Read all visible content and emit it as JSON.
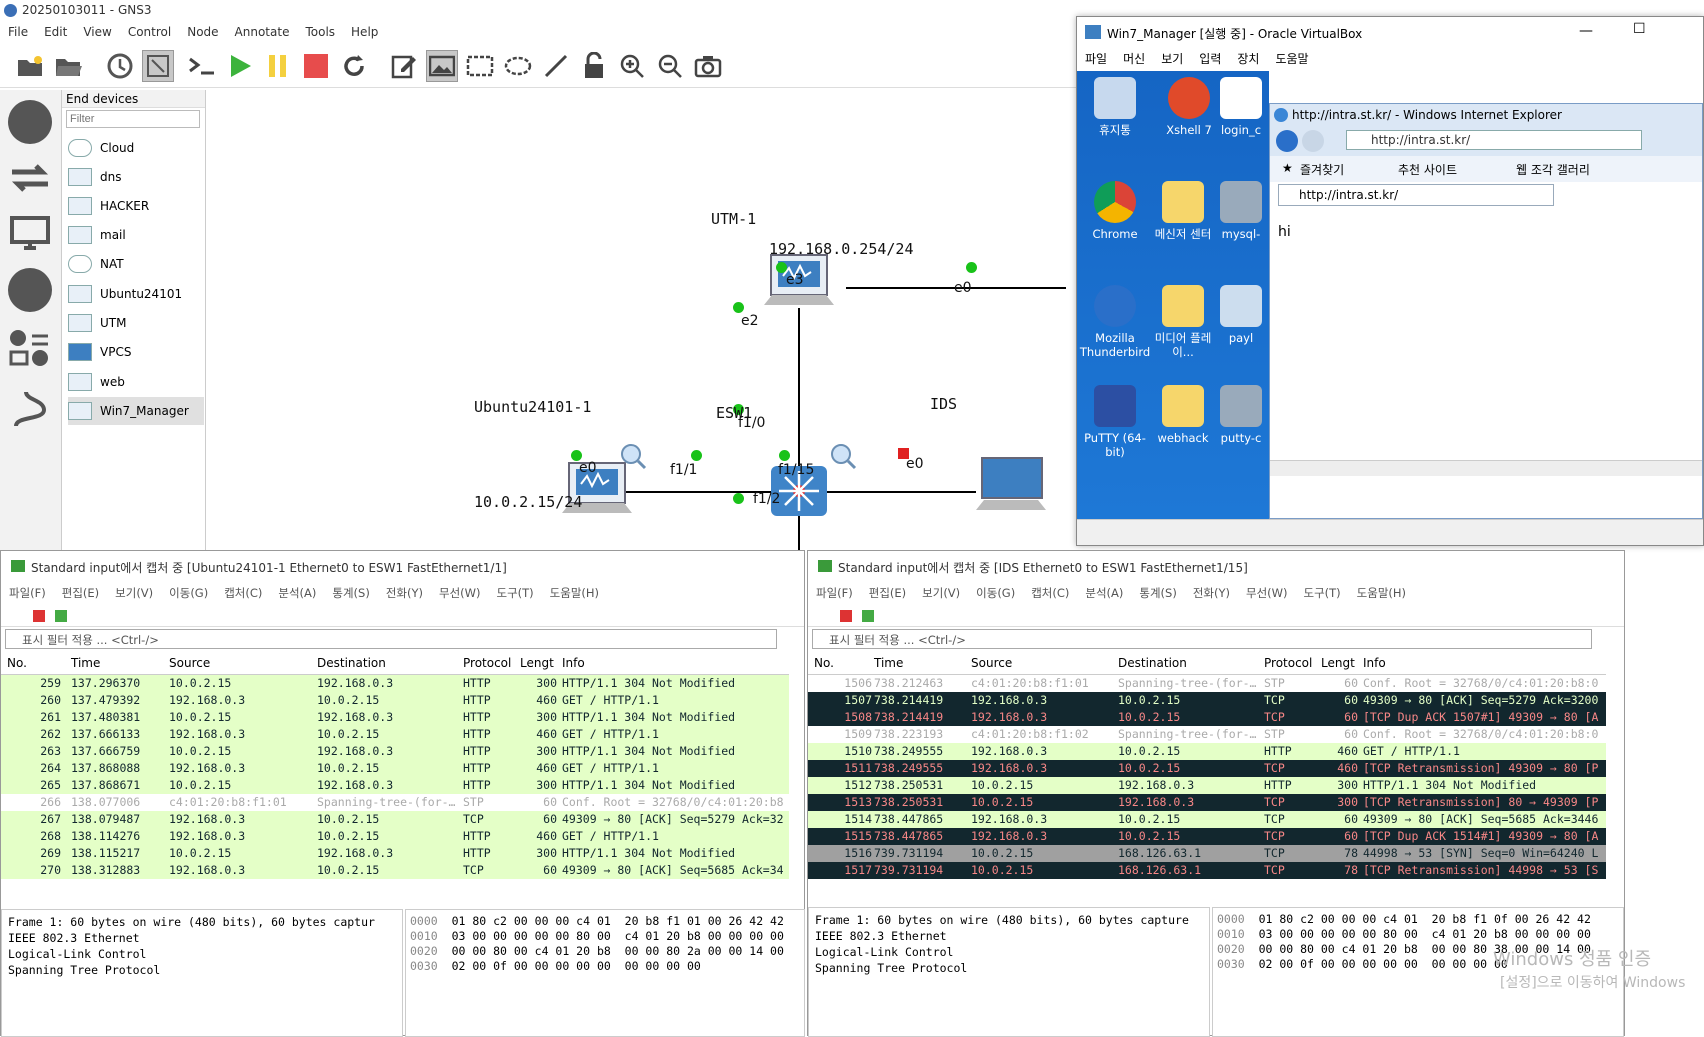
{
  "gns": {
    "title": "20250103011 - GNS3",
    "menu": [
      "File",
      "Edit",
      "View",
      "Control",
      "Node",
      "Annotate",
      "Tools",
      "Help"
    ],
    "panel_title": "End devices",
    "filter_placeholder": "Filter",
    "devices": [
      "Cloud",
      "dns",
      "HACKER",
      "mail",
      "NAT",
      "Ubuntu24101",
      "UTM",
      "VPCS",
      "web",
      "Win7_Manager"
    ],
    "selected_device": "Win7_Manager",
    "nodes": {
      "utm": {
        "name": "UTM-1",
        "ip": "192.168.0.254/24"
      },
      "ubuntu": {
        "name": "Ubuntu24101-1",
        "ip": "10.0.2.15/24"
      },
      "esw": {
        "name": "ESW1"
      },
      "ids": {
        "name": "IDS",
        "box": "VPCS"
      }
    },
    "ports": {
      "e3": "e3",
      "e0_utm_right": "e0",
      "e2": "e2",
      "e0_ubuntu": "e0",
      "f1_1": "f1/1",
      "f1_0": "f1/0",
      "f1_15": "f1/15",
      "e0_ids": "e0",
      "f1_2": "f1/2"
    }
  },
  "vbox": {
    "title": "Win7_Manager [실행 중] - Oracle VirtualBox",
    "menu": [
      "파일",
      "머신",
      "보기",
      "입력",
      "장치",
      "도움말"
    ],
    "desktop_icons": [
      "휴지통",
      "Xshell 7",
      "login_c",
      "Chrome",
      "메신저 센터",
      "mysql-",
      "Mozilla Thunderbird",
      "미디어 플레이...",
      "payl",
      "PuTTY (64-bit)",
      "webhack",
      "putty-c"
    ],
    "ie": {
      "title": "http://intra.st.kr/ - Windows Internet Explorer",
      "address": "http://intra.st.kr/",
      "favorites": "즐겨찾기",
      "suggested": "추천 사이트",
      "gallery": "웹 조각 갤러리",
      "tab": "http://intra.st.kr/",
      "content": "hi"
    }
  },
  "ws_left": {
    "title": "Standard input에서 캡처 중 [Ubuntu24101-1 Ethernet0 to ESW1 FastEthernet1/1]",
    "menu": [
      "파일(F)",
      "편집(E)",
      "보기(V)",
      "이동(G)",
      "캡처(C)",
      "분석(A)",
      "통계(S)",
      "전화(Y)",
      "무선(W)",
      "도구(T)",
      "도움말(H)"
    ],
    "filter": "표시 필터 적용 ... <Ctrl-/>",
    "columns": [
      "No.",
      "Time",
      "Source",
      "Destination",
      "Protocol",
      "Lengt",
      "Info"
    ],
    "rows": [
      {
        "cls": "r-http",
        "no": "259",
        "time": "137.296370",
        "src": "10.0.2.15",
        "dst": "192.168.0.3",
        "proto": "HTTP",
        "len": "300",
        "info": "HTTP/1.1 304 Not Modified"
      },
      {
        "cls": "r-http",
        "no": "260",
        "time": "137.479392",
        "src": "192.168.0.3",
        "dst": "10.0.2.15",
        "proto": "HTTP",
        "len": "460",
        "info": "GET / HTTP/1.1"
      },
      {
        "cls": "r-http",
        "no": "261",
        "time": "137.480381",
        "src": "10.0.2.15",
        "dst": "192.168.0.3",
        "proto": "HTTP",
        "len": "300",
        "info": "HTTP/1.1 304 Not Modified"
      },
      {
        "cls": "r-http",
        "no": "262",
        "time": "137.666133",
        "src": "192.168.0.3",
        "dst": "10.0.2.15",
        "proto": "HTTP",
        "len": "460",
        "info": "GET / HTTP/1.1"
      },
      {
        "cls": "r-http",
        "no": "263",
        "time": "137.666759",
        "src": "10.0.2.15",
        "dst": "192.168.0.3",
        "proto": "HTTP",
        "len": "300",
        "info": "HTTP/1.1 304 Not Modified"
      },
      {
        "cls": "r-http",
        "no": "264",
        "time": "137.868088",
        "src": "192.168.0.3",
        "dst": "10.0.2.15",
        "proto": "HTTP",
        "len": "460",
        "info": "GET / HTTP/1.1"
      },
      {
        "cls": "r-http",
        "no": "265",
        "time": "137.868671",
        "src": "10.0.2.15",
        "dst": "192.168.0.3",
        "proto": "HTTP",
        "len": "300",
        "info": "HTTP/1.1 304 Not Modified"
      },
      {
        "cls": "r-stp",
        "no": "266",
        "time": "138.077006",
        "src": "c4:01:20:b8:f1:01",
        "dst": "Spanning-tree-(for-…",
        "proto": "STP",
        "len": "60",
        "info": "Conf. Root = 32768/0/c4:01:20:b8"
      },
      {
        "cls": "r-http",
        "no": "267",
        "time": "138.079487",
        "src": "192.168.0.3",
        "dst": "10.0.2.15",
        "proto": "TCP",
        "len": "60",
        "info": "49309 → 80 [ACK] Seq=5279 Ack=32"
      },
      {
        "cls": "r-http",
        "no": "268",
        "time": "138.114276",
        "src": "192.168.0.3",
        "dst": "10.0.2.15",
        "proto": "HTTP",
        "len": "460",
        "info": "GET / HTTP/1.1"
      },
      {
        "cls": "r-http",
        "no": "269",
        "time": "138.115217",
        "src": "10.0.2.15",
        "dst": "192.168.0.3",
        "proto": "HTTP",
        "len": "300",
        "info": "HTTP/1.1 304 Not Modified"
      },
      {
        "cls": "r-http",
        "no": "270",
        "time": "138.312883",
        "src": "192.168.0.3",
        "dst": "10.0.2.15",
        "proto": "TCP",
        "len": "60",
        "info": "49309 → 80 [ACK] Seq=5685 Ack=34"
      }
    ],
    "tree": [
      "Frame 1: 60 bytes on wire (480 bits), 60 bytes captur",
      "IEEE 802.3 Ethernet",
      "Logical-Link Control",
      "Spanning Tree Protocol"
    ],
    "hex": [
      {
        "off": "0000",
        "bytes": "01 80 c2 00 00 00 c4 01  20 b8 f1 01 00 26 42 42"
      },
      {
        "off": "0010",
        "bytes": "03 00 00 00 00 00 80 00  c4 01 20 b8 00 00 00 00"
      },
      {
        "off": "0020",
        "bytes": "00 00 80 00 c4 01 20 b8  00 00 80 2a 00 00 14 00"
      },
      {
        "off": "0030",
        "bytes": "02 00 0f 00 00 00 00 00  00 00 00 00"
      }
    ]
  },
  "ws_right": {
    "title": "Standard input에서 캡처 중 [IDS Ethernet0 to ESW1 FastEthernet1/15]",
    "menu": [
      "파일(F)",
      "편집(E)",
      "보기(V)",
      "이동(G)",
      "캡처(C)",
      "분석(A)",
      "통계(S)",
      "전화(Y)",
      "무선(W)",
      "도구(T)",
      "도움말(H)"
    ],
    "filter": "표시 필터 적용 ... <Ctrl-/>",
    "columns": [
      "No.",
      "Time",
      "Source",
      "Destination",
      "Protocol",
      "Lengt",
      "Info"
    ],
    "rows": [
      {
        "cls": "r-stp",
        "no": "1506",
        "time": "738.212463",
        "src": "c4:01:20:b8:f1:01",
        "dst": "Spanning-tree-(for-…",
        "proto": "STP",
        "len": "60",
        "info": "Conf. Root = 32768/0/c4:01:20:b8:0"
      },
      {
        "cls": "r-dark grn",
        "no": "1507",
        "time": "738.214419",
        "src": "192.168.0.3",
        "dst": "10.0.2.15",
        "proto": "TCP",
        "len": "60",
        "info": "49309 → 80 [ACK] Seq=5279 Ack=3200"
      },
      {
        "cls": "r-dark",
        "no": "1508",
        "time": "738.214419",
        "src": "192.168.0.3",
        "dst": "10.0.2.15",
        "proto": "TCP",
        "len": "60",
        "info": "[TCP Dup ACK 1507#1] 49309 → 80 [A"
      },
      {
        "cls": "r-stp",
        "no": "1509",
        "time": "738.223193",
        "src": "c4:01:20:b8:f1:02",
        "dst": "Spanning-tree-(for-…",
        "proto": "STP",
        "len": "60",
        "info": "Conf. Root = 32768/0/c4:01:20:b8:0"
      },
      {
        "cls": "r-http",
        "no": "1510",
        "time": "738.249555",
        "src": "192.168.0.3",
        "dst": "10.0.2.15",
        "proto": "HTTP",
        "len": "460",
        "info": "GET / HTTP/1.1"
      },
      {
        "cls": "r-dark",
        "no": "1511",
        "time": "738.249555",
        "src": "192.168.0.3",
        "dst": "10.0.2.15",
        "proto": "TCP",
        "len": "460",
        "info": "[TCP Retransmission] 49309 → 80 [P"
      },
      {
        "cls": "r-http",
        "no": "1512",
        "time": "738.250531",
        "src": "10.0.2.15",
        "dst": "192.168.0.3",
        "proto": "HTTP",
        "len": "300",
        "info": "HTTP/1.1 304 Not Modified"
      },
      {
        "cls": "r-dark",
        "no": "1513",
        "time": "738.250531",
        "src": "10.0.2.15",
        "dst": "192.168.0.3",
        "proto": "TCP",
        "len": "300",
        "info": "[TCP Retransmission] 80 → 49309 [P"
      },
      {
        "cls": "r-http",
        "no": "1514",
        "time": "738.447865",
        "src": "192.168.0.3",
        "dst": "10.0.2.15",
        "proto": "TCP",
        "len": "60",
        "info": "49309 → 80 [ACK] Seq=5685 Ack=3446"
      },
      {
        "cls": "r-dark",
        "no": "1515",
        "time": "738.447865",
        "src": "192.168.0.3",
        "dst": "10.0.2.15",
        "proto": "TCP",
        "len": "60",
        "info": "[TCP Dup ACK 1514#1] 49309 → 80 [A"
      },
      {
        "cls": "r-sel",
        "no": "1516",
        "time": "739.731194",
        "src": "10.0.2.15",
        "dst": "168.126.63.1",
        "proto": "TCP",
        "len": "78",
        "info": "44998 → 53 [SYN] Seq=0 Win=64240 L"
      },
      {
        "cls": "r-dark",
        "no": "1517",
        "time": "739.731194",
        "src": "10.0.2.15",
        "dst": "168.126.63.1",
        "proto": "TCP",
        "len": "78",
        "info": "[TCP Retransmission] 44998 → 53 [S"
      }
    ],
    "tree": [
      "Frame 1: 60 bytes on wire (480 bits), 60 bytes capture",
      "IEEE 802.3 Ethernet",
      "Logical-Link Control",
      "Spanning Tree Protocol"
    ],
    "hex": [
      {
        "off": "0000",
        "bytes": "01 80 c2 00 00 00 c4 01  20 b8 f1 0f 00 26 42 42"
      },
      {
        "off": "0010",
        "bytes": "03 00 00 00 00 00 80 00  c4 01 20 b8 00 00 00 00"
      },
      {
        "off": "0020",
        "bytes": "00 00 80 00 c4 01 20 b8  00 00 80 38 00 00 14 00"
      },
      {
        "off": "0030",
        "bytes": "02 00 0f 00 00 00 00 00  00 00 00 00"
      }
    ]
  },
  "watermark": {
    "line1": "Windows 정품 인증",
    "line2": "[설정]으로 이동하여 Windows"
  }
}
